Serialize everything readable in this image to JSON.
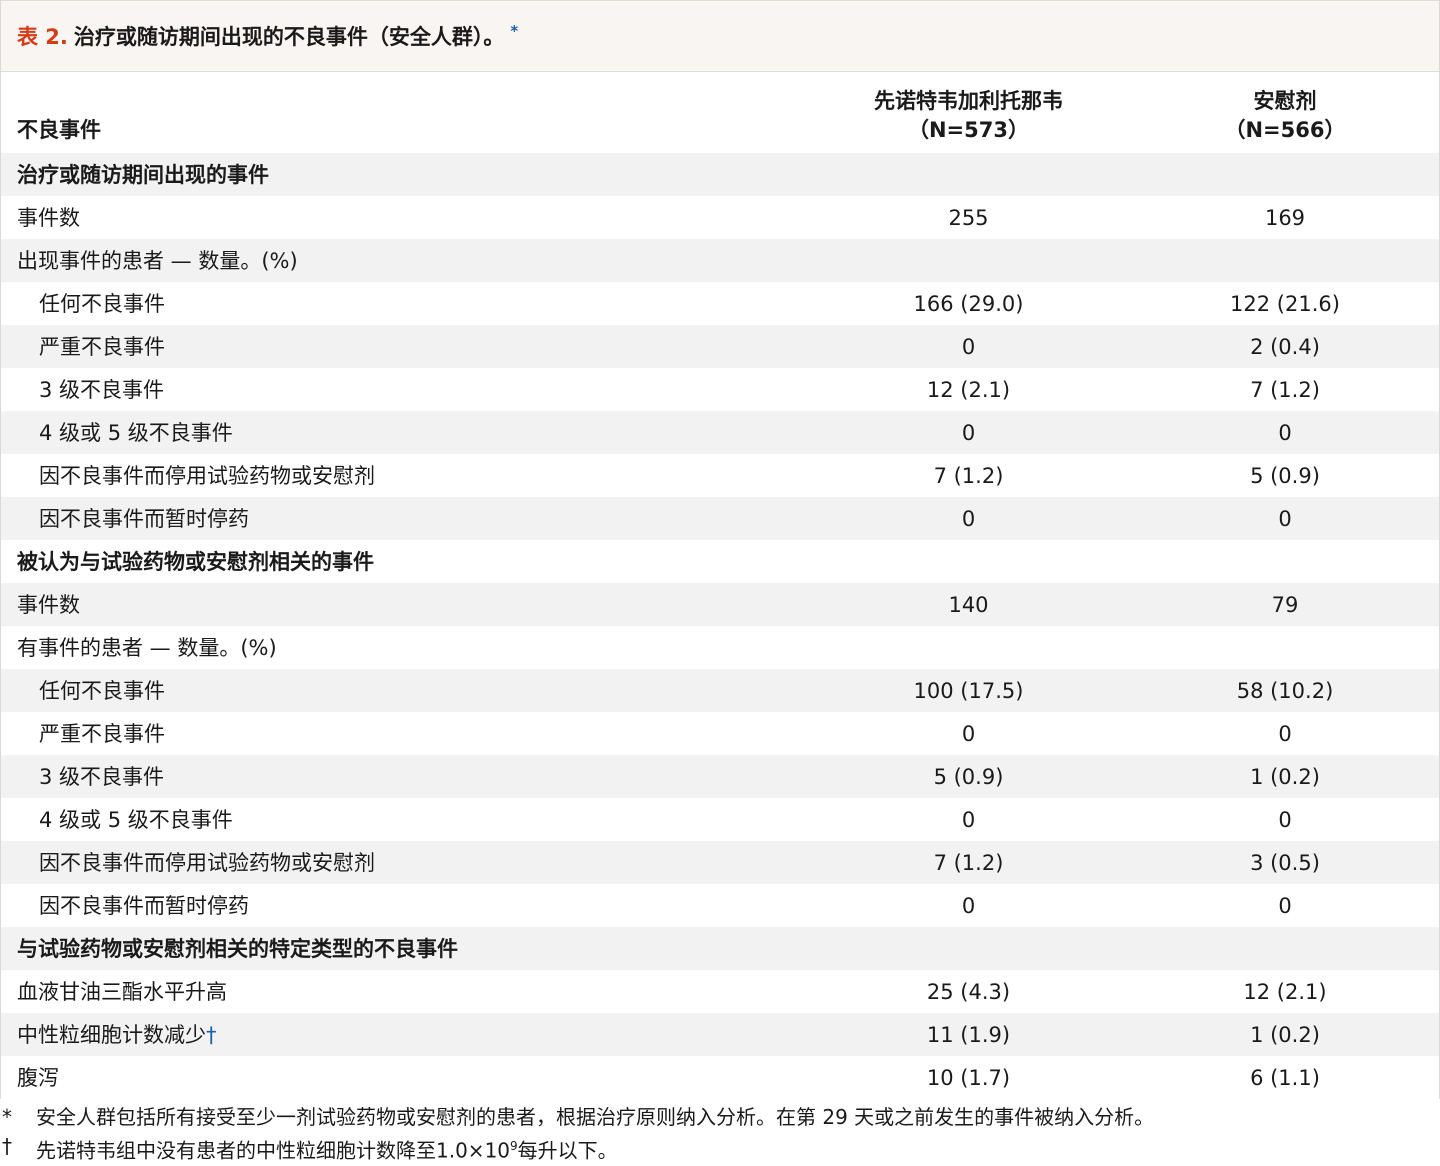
{
  "title": {
    "number": "表 2.",
    "text": "治疗或随访期间出现的不良事件（安全人群）。",
    "marker": "*"
  },
  "header": {
    "col1": "不良事件",
    "col2_line1": "先诺特韦加利托那韦",
    "col2_line2": "（N=573）",
    "col3_line1": "安慰剂",
    "col3_line2": "（N=566）"
  },
  "rows": [
    {
      "label": "治疗或随访期间出现的事件",
      "a": "",
      "b": ""
    },
    {
      "label": "事件数",
      "a": "255",
      "b": "169"
    },
    {
      "label": "出现事件的患者 — 数量。(%)",
      "a": "",
      "b": ""
    },
    {
      "label": "任何不良事件",
      "a": "166 (29.0)",
      "b": "122 (21.6)"
    },
    {
      "label": "严重不良事件",
      "a": "0",
      "b": "2 (0.4)"
    },
    {
      "label": "3 级不良事件",
      "a": "12 (2.1)",
      "b": "7 (1.2)"
    },
    {
      "label": "4 级或 5 级不良事件",
      "a": "0",
      "b": "0"
    },
    {
      "label": "因不良事件而停用试验药物或安慰剂",
      "a": "7 (1.2)",
      "b": "5 (0.9)"
    },
    {
      "label": "因不良事件而暂时停药",
      "a": "0",
      "b": "0"
    },
    {
      "label": "被认为与试验药物或安慰剂相关的事件",
      "a": "",
      "b": ""
    },
    {
      "label": "事件数",
      "a": "140",
      "b": "79"
    },
    {
      "label": "有事件的患者 — 数量。(%)",
      "a": "",
      "b": ""
    },
    {
      "label": "任何不良事件",
      "a": "100 (17.5)",
      "b": "58 (10.2)"
    },
    {
      "label": "严重不良事件",
      "a": "0",
      "b": "0"
    },
    {
      "label": "3 级不良事件",
      "a": "5 (0.9)",
      "b": "1 (0.2)"
    },
    {
      "label": "4 级或 5 级不良事件",
      "a": "0",
      "b": "0"
    },
    {
      "label": "因不良事件而停用试验药物或安慰剂",
      "a": "7 (1.2)",
      "b": "3 (0.5)"
    },
    {
      "label": "因不良事件而暂时停药",
      "a": "0",
      "b": "0"
    },
    {
      "label": "与试验药物或安慰剂相关的特定类型的不良事件",
      "a": "",
      "b": ""
    },
    {
      "label": "血液甘油三酯水平升高",
      "a": "25 (4.3)",
      "b": "12 (2.1)"
    },
    {
      "label": "中性粒细胞计数减少",
      "a": "11 (1.9)",
      "b": "1 (0.2)"
    },
    {
      "label": "腹泻",
      "a": "10 (1.7)",
      "b": "6 (1.1)"
    }
  ],
  "row21_marker": "†",
  "footnotes": {
    "fn1_mark": "*",
    "fn1_text": "安全人群包括所有接受至少一剂试验药物或安慰剂的患者，根据治疗原则纳入分析。在第 29 天或之前发生的事件被纳入分析。",
    "fn2_mark": "†",
    "fn2_text_a": "先诺特韦组中没有患者的中性粒细胞计数降至1.0×10",
    "fn2_sup": "9",
    "fn2_text_b": "每升以下。"
  }
}
